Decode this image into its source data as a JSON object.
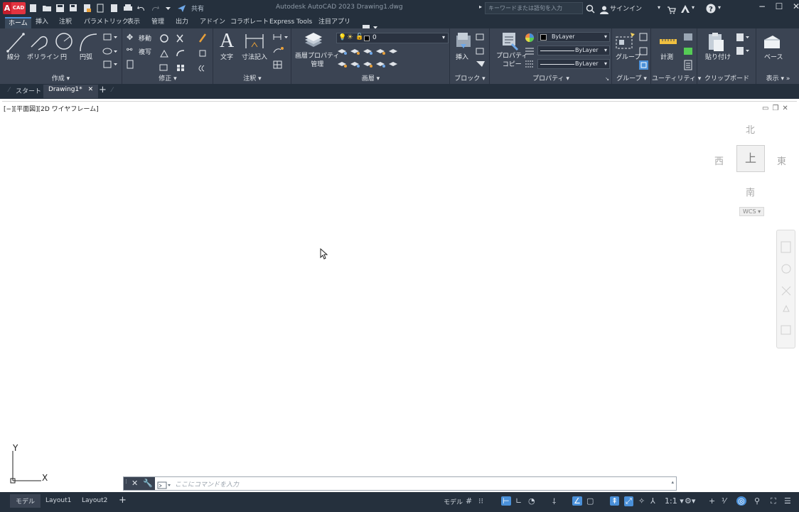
{
  "titlebar": {
    "logo_a": "A",
    "logo_b": "CAD",
    "share_label": "共有",
    "app_title": "Autodesk AutoCAD 2023    Drawing1.dwg",
    "search_placeholder": "キーワードまたは語句を入力",
    "signin_label": "サインイン"
  },
  "ribbon_tabs": [
    "ホーム",
    "挿入",
    "注釈",
    "パラメトリック",
    "表示",
    "管理",
    "出力",
    "アドイン",
    "コラボレート",
    "Express Tools",
    "注目アプリ"
  ],
  "ribbon": {
    "draw": {
      "label": "作成 ▾",
      "line": "線分",
      "polyline": "ポリライン",
      "circle": "円",
      "arc": "円弧"
    },
    "modify": {
      "label": "修正 ▾",
      "move": "移動",
      "copy": "複写"
    },
    "annotation": {
      "label": "注釈 ▾",
      "text": "文字",
      "dimension": "寸法記入"
    },
    "layers": {
      "label": "画層 ▾",
      "props": "画層プロパティ",
      "props2": "管理",
      "current_layer": "0"
    },
    "block": {
      "label": "ブロック ▾",
      "insert": "挿入"
    },
    "properties": {
      "label": "プロパティ ▾",
      "match": "プロパティ",
      "match2": "コピー",
      "color": "ByLayer",
      "linetype": "ByLayer",
      "lineweight": "ByLayer"
    },
    "groups": {
      "label": "グループ ▾",
      "group": "グループ"
    },
    "utilities": {
      "label": "ユーティリティ ▾",
      "measure": "計測"
    },
    "clipboard": {
      "label": "クリップボード",
      "paste": "貼り付け"
    },
    "view": {
      "label": "表示 ▾ »",
      "base": "ベース"
    }
  },
  "file_tabs": {
    "start": "スタート",
    "drawing": "Drawing1*",
    "add": "+"
  },
  "viewport": {
    "label": "[−][平面図][2D ワイヤフレーム]",
    "north": "北",
    "south": "南",
    "east": "東",
    "west": "西",
    "top": "上",
    "wcs": "WCS ▾",
    "ucs_y": "Y",
    "ucs_x": "X"
  },
  "command": {
    "placeholder": "ここにコマンドを入力"
  },
  "status": {
    "tabs": [
      "モデル",
      "Layout1",
      "Layout2"
    ],
    "add": "+",
    "model_label": "モデル",
    "scale": "1:1 ▾"
  }
}
